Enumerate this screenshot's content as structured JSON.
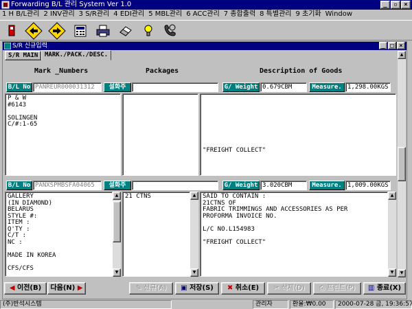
{
  "app": {
    "title": "Forwarding B/L 관리 System Ver 1.0"
  },
  "menu": [
    "1 H B/L관리",
    "2 INV관리",
    "3 S/R관리",
    "4 EDI관리",
    "5 MBL관리",
    "6 ACC관리",
    "7 종합출력",
    "8 특별관리",
    "9 초기화",
    "Window"
  ],
  "toolbar": [
    "exit-icon",
    "back-arrow-icon",
    "forward-arrow-icon",
    "calculator-icon",
    "printer-icon",
    "eraser-icon",
    "lightbulb-icon",
    "phone-icon"
  ],
  "window": {
    "title": "S/R 신규입력"
  },
  "tabs": [
    "S/R MAIN",
    "MARK./PACK./DESC."
  ],
  "headers": {
    "marks": "Mark _Numbers",
    "packages": "Packages",
    "description": "Description of Goods"
  },
  "labels": {
    "bl_no": "B/L No",
    "shipper_btn": "설화주",
    "weight": "G/ Weight",
    "measure": "Measure."
  },
  "records": [
    {
      "bl_no": "PANREUR000031312",
      "shipper": "",
      "weight": "0.679CBM",
      "measure": "1,298.00KGS",
      "marks": "P & W\n#6143\n\nSOLINGEN\nC/#:1-65",
      "packages": "",
      "description": "\n\n\n\n\n\n\n\n\"FREIGHT COLLECT\""
    },
    {
      "bl_no": "PANXSPMBSFA04065",
      "shipper": "",
      "weight": "3.020CBM",
      "measure": "1,009.00KGS",
      "marks": "GALLERY\n(IN DIAMOND)\nBELARUS\nSTYLE #:\nITEM :\nQ'TY :\nC/T :\nNC :\n\nMADE IN KOREA\n\nCFS/CFS",
      "packages": "21 CTNS",
      "description": "SAID TO CONTAIN :\n21CTNS OF\nFABRIC TRIMMINGS AND ACCESSORIES AS PER\nPROFORMA INVOICE NO.\n\nL/C NO.L154983\n\n\"FREIGHT COLLECT\""
    }
  ],
  "buttons": {
    "prev": "이전(B)",
    "next": "다음(N)",
    "new": "신규(A)",
    "save": "저장(S)",
    "cancel": "취소(E)",
    "delete": "삭제(D)",
    "print": "프린트(P)",
    "close": "종료(X)"
  },
  "status": {
    "company": "(주)반석시스템",
    "user": "관리자",
    "rate": "환율:₩0.00",
    "datetime": "2000-07-28 금, 19:36:57"
  },
  "colors": {
    "title_bar": "#000080",
    "label_bg": "#008080",
    "face": "#c0c0c0"
  }
}
